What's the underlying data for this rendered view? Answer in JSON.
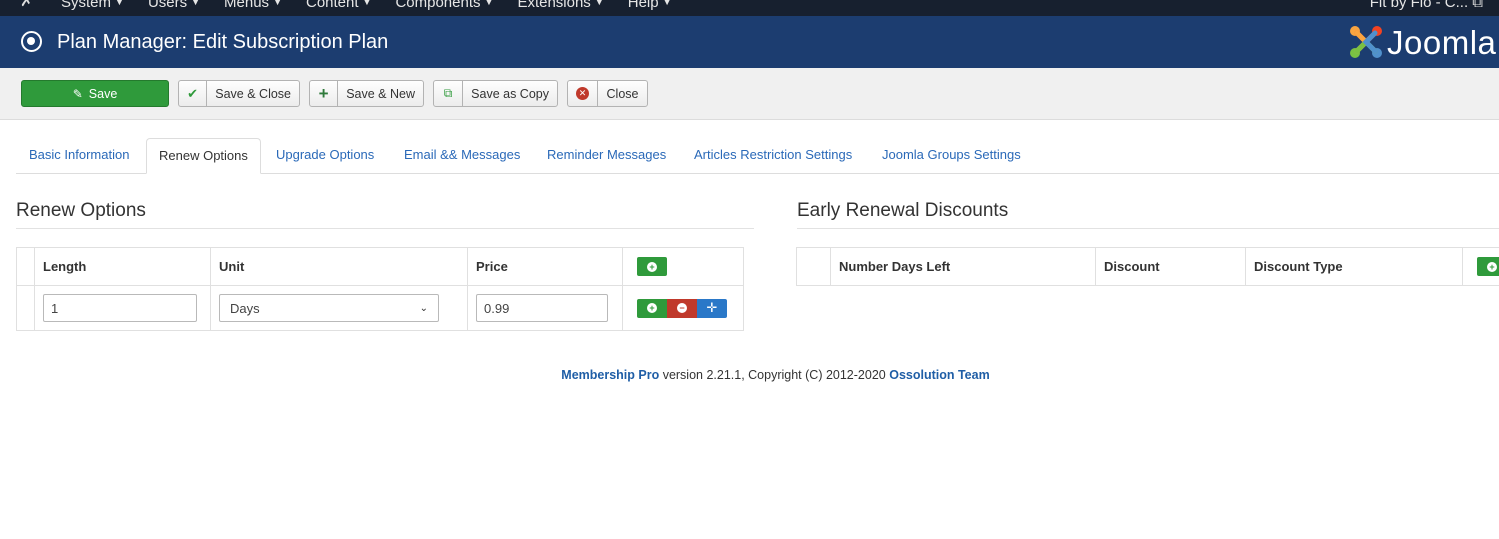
{
  "topnav": {
    "menu": [
      "System",
      "Users",
      "Menus",
      "Content",
      "Components",
      "Extensions",
      "Help"
    ],
    "site_link": "Fit by Flo - C..."
  },
  "header": {
    "title": "Plan Manager: Edit Subscription Plan",
    "logo_text": "Joomla"
  },
  "toolbar": {
    "save": "Save",
    "save_close": "Save & Close",
    "save_new": "Save & New",
    "save_copy": "Save as Copy",
    "close": "Close"
  },
  "tabs": [
    "Basic Information",
    "Renew Options",
    "Upgrade Options",
    "Email && Messages",
    "Reminder Messages",
    "Articles Restriction Settings",
    "Joomla Groups Settings"
  ],
  "active_tab": "Renew Options",
  "renew": {
    "title": "Renew Options",
    "columns": [
      "Length",
      "Unit",
      "Price"
    ],
    "rows": [
      {
        "length": "1",
        "unit": "Days",
        "price": "0.99"
      }
    ]
  },
  "early": {
    "title": "Early Renewal Discounts",
    "columns": [
      "Number Days Left",
      "Discount",
      "Discount Type"
    ]
  },
  "footer": {
    "product": "Membership Pro",
    "text": " version 2.21.1, Copyright (C) 2012-2020 ",
    "team": "Ossolution Team"
  },
  "colors": {
    "header_bg": "#1c3d70",
    "topnav_bg": "#17202f",
    "save_green": "#2f9a3b",
    "remove_red": "#c0392b",
    "move_blue": "#2a78c8",
    "link_blue": "#2a69b8"
  }
}
